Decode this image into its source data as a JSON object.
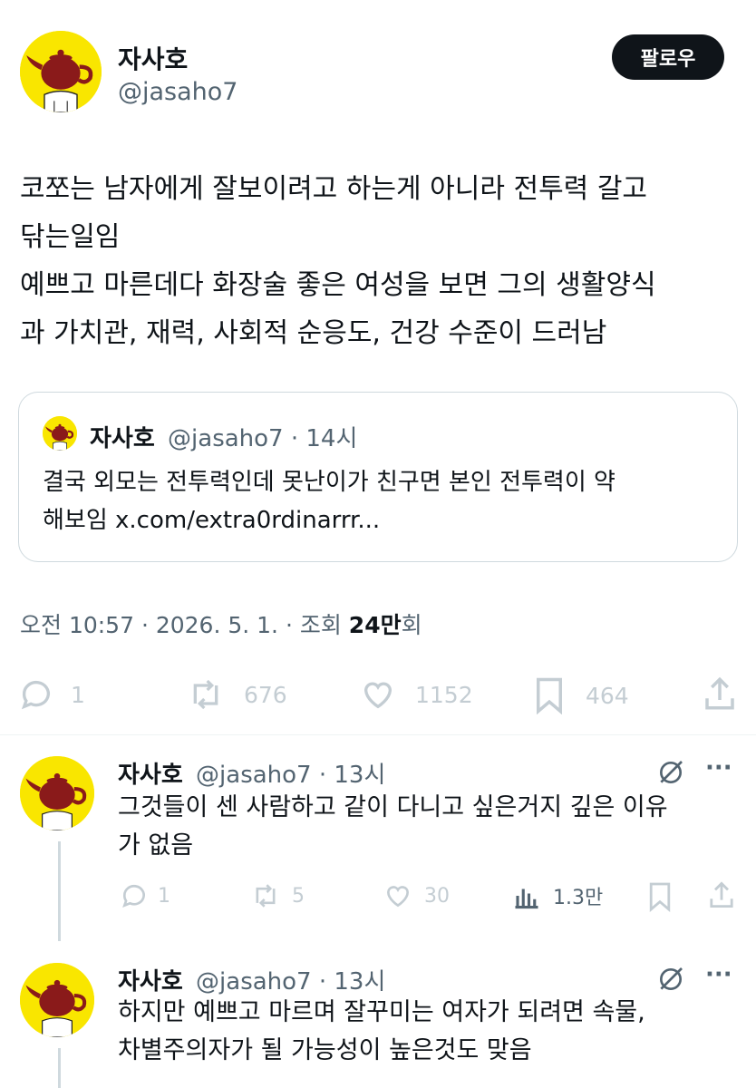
{
  "author": {
    "name": "자사호",
    "handle": "@jasaho7"
  },
  "follow_label": "팔로우",
  "tweet": {
    "lines": [
      "코쪼는 남자에게 잘보이려고 하는게 아니라 전투력 갈고",
      "닦는일임",
      "예쁘고 마른데다 화장술 좋은 여성을 보면 그의 생활양식",
      "과 가치관, 재력, 사회적 순응도, 건강 수준이 드러남"
    ]
  },
  "quote": {
    "name": "자사호",
    "handle": "@jasaho7",
    "time": "· 14시",
    "lines": [
      "결국 외모는 전투력인데 못난이가 친구면 본인 전투력이 약",
      "해보임 x.com/extra0rdinarrr..."
    ]
  },
  "meta": {
    "prefix": "오전 10:57 · 2026. 5. 1. · 조회 ",
    "views": "24만",
    "suffix": "회"
  },
  "actions": {
    "replies": "1",
    "reposts": "676",
    "likes": "1152",
    "bookmarks": "464"
  },
  "replies": [
    {
      "name": "자사호",
      "handle": "@jasaho7",
      "time": "· 13시",
      "more": "···",
      "lines": [
        "그것들이 센 사람하고 같이 다니고 싶은거지 깊은 이유",
        "가 없음"
      ],
      "counts": {
        "replies": "1",
        "reposts": "5",
        "likes": "30",
        "views": "1.3만"
      }
    },
    {
      "name": "자사호",
      "handle": "@jasaho7",
      "time": "· 13시",
      "more": "···",
      "lines": [
        "하지만 예쁘고 마르며 잘꾸미는 여자가 되려면 속물,",
        "차별주의자가 될 가능성이 높은것도 맞음"
      ]
    }
  ],
  "colors": {
    "avatar_bg": "#f9e600",
    "teapot": "#8a1a1a",
    "follow_bg": "#0f1419",
    "text": "#0f1419",
    "gray": "#536471",
    "icon": "#c4cdd3"
  }
}
